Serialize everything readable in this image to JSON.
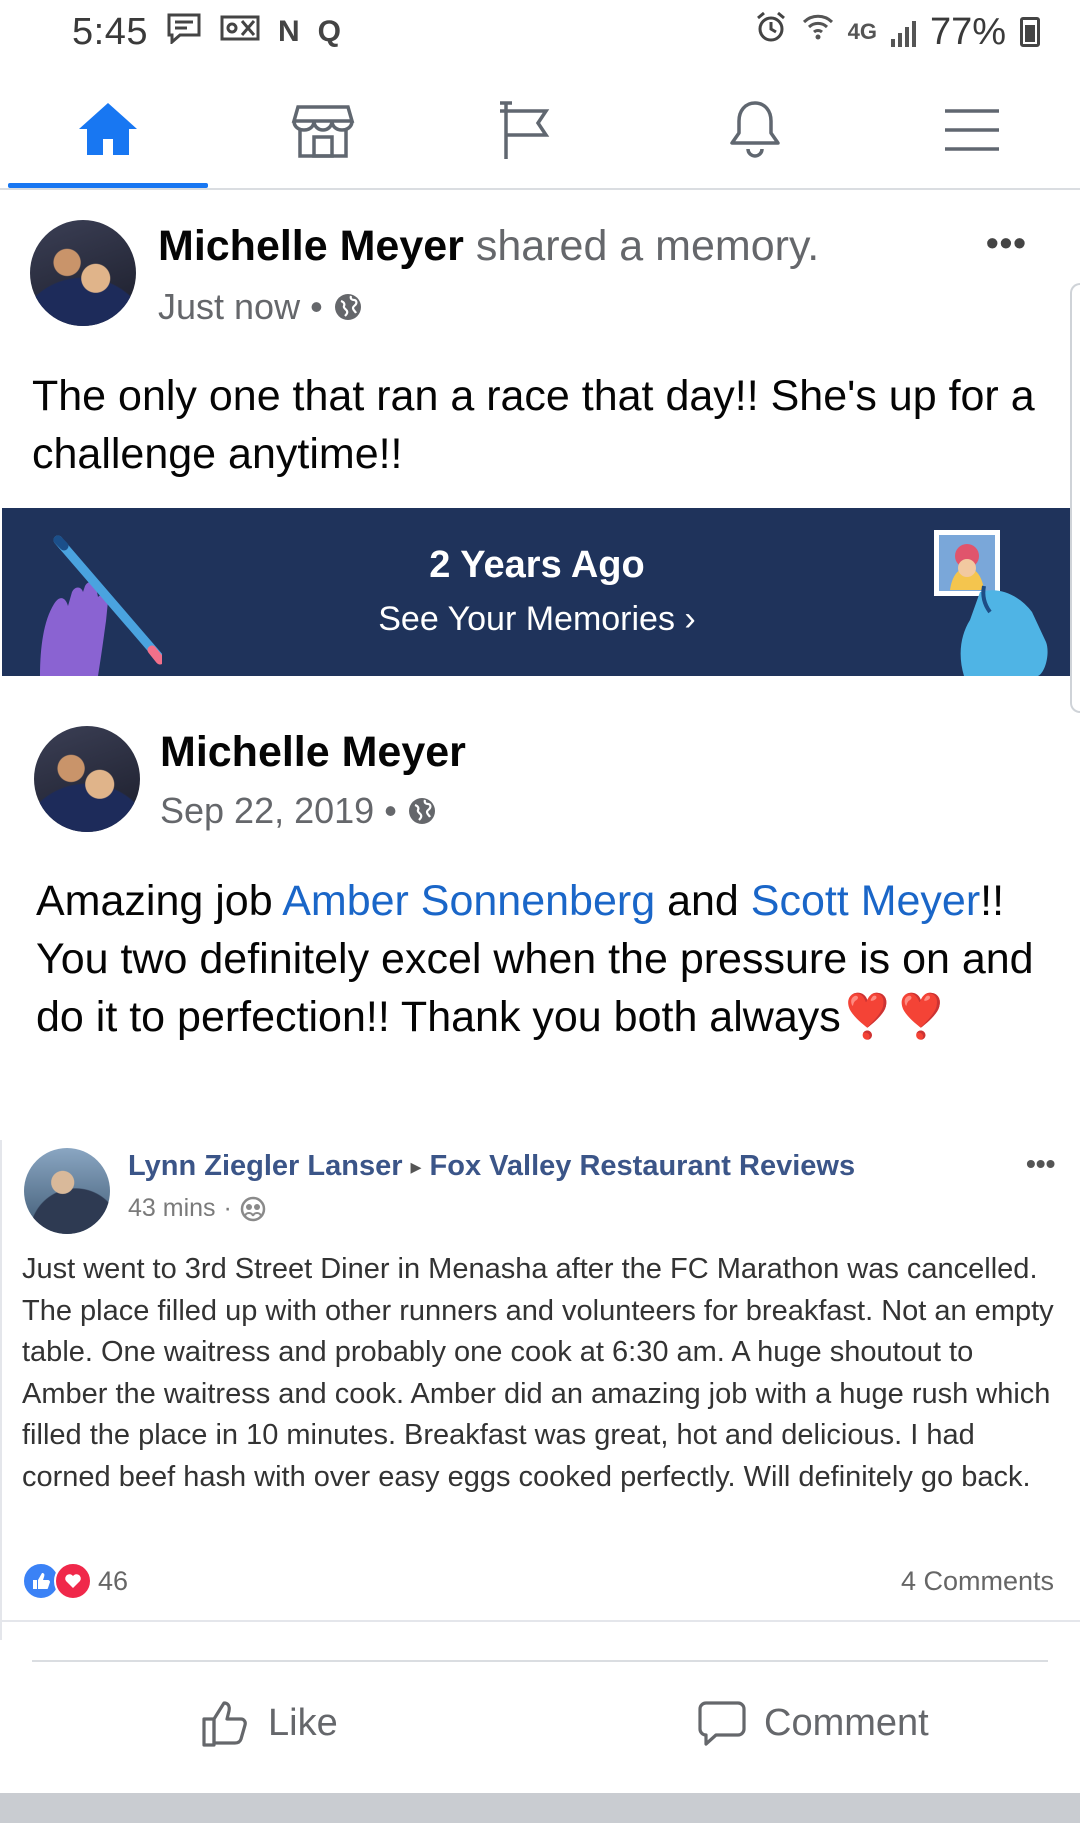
{
  "status_bar": {
    "time": "5:45",
    "left_icons": [
      "message-icon",
      "voicemail-icon",
      "n-icon",
      "q-icon"
    ],
    "network": "4G",
    "battery": "77%"
  },
  "nav": {
    "items": [
      {
        "name": "home-icon",
        "active": true
      },
      {
        "name": "marketplace-icon",
        "active": false
      },
      {
        "name": "pages-flag-icon",
        "active": false
      },
      {
        "name": "notifications-bell-icon",
        "active": false
      },
      {
        "name": "menu-icon",
        "active": false
      }
    ],
    "active_color": "#1877f2"
  },
  "post": {
    "author": "Michelle Meyer",
    "action": "shared a memory.",
    "time": "Just now",
    "dot": "•",
    "more": "•••",
    "text": "The only one that ran a race that day!! She's up for a challenge anytime!!"
  },
  "memory_banner": {
    "title": "2 Years Ago",
    "subtitle": "See Your Memories",
    "chevron": "›",
    "background": "#1f335b"
  },
  "shared_post": {
    "author": "Michelle Meyer",
    "date": "Sep 22, 2019",
    "dot": "•",
    "text_part1": "Amazing job ",
    "mention1": "Amber Sonnenberg",
    "text_part2": " and ",
    "mention2": "Scott Meyer",
    "text_part3": "!! You two definitely excel when the pressure is on and do it to perfection!! Thank you both always",
    "emoji": "❣️❣️"
  },
  "embedded_post": {
    "author": "Lynn Ziegler Lanser",
    "arrow": "▸",
    "group": "Fox Valley Restaurant Reviews",
    "time": "43 mins",
    "dot": "·",
    "more": "•••",
    "text": "Just went to 3rd Street Diner in Menasha after the FC Marathon was cancelled. The place filled up with other runners and volunteers for breakfast. Not an empty table. One waitress and probably one cook at 6:30 am. A huge shoutout to Amber the waitress and cook. Amber did an amazing job with a huge rush which filled the place in 10 minutes. Breakfast was great, hot and delicious. I had corned beef hash with over easy eggs cooked perfectly. Will definitely go back.",
    "reaction_count": "46",
    "comments": "4 Comments"
  },
  "actions": {
    "like": "Like",
    "comment": "Comment"
  }
}
